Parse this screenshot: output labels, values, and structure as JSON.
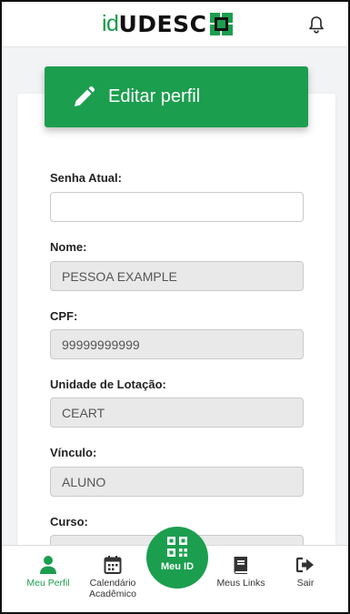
{
  "header": {
    "logo_prefix": "id",
    "logo_name": "UDESC",
    "brand_color": "#1c9e4f",
    "notification_icon": "bell-icon"
  },
  "card": {
    "title": "Editar perfil",
    "title_icon": "pencil-icon"
  },
  "form": {
    "senha_atual": {
      "label": "Senha Atual:",
      "value": ""
    },
    "nome": {
      "label": "Nome:",
      "value": "PESSOA EXAMPLE"
    },
    "cpf": {
      "label": "CPF:",
      "value": "99999999999"
    },
    "unidade": {
      "label": "Unidade de Lotação:",
      "value": "CEART"
    },
    "vinculo": {
      "label": "Vínculo:",
      "value": "ALUNO"
    },
    "curso": {
      "label": "Curso:",
      "value": ""
    }
  },
  "nav": {
    "meu_perfil": "Meu Perfil",
    "calendario_line1": "Calendário",
    "calendario_line2": "Acadêmico",
    "meu_id": "Meu ID",
    "meus_links": "Meus Links",
    "sair": "Sair"
  }
}
